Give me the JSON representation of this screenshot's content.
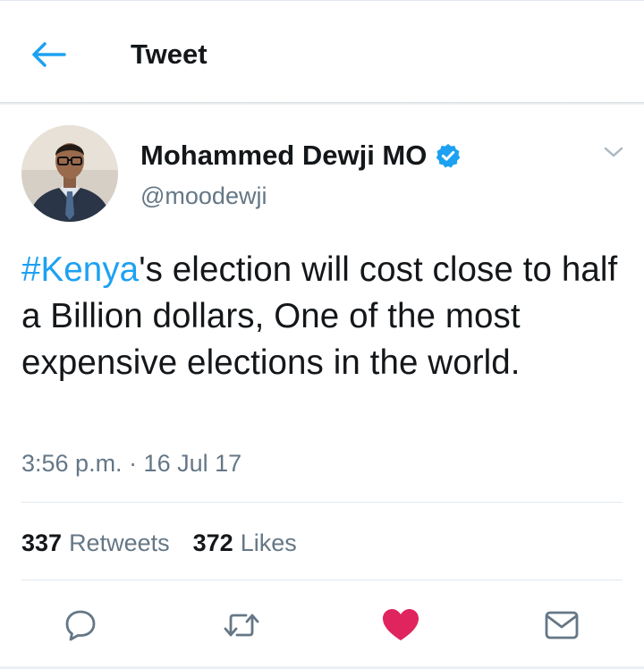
{
  "header": {
    "title": "Tweet",
    "back_icon": "back-arrow-icon"
  },
  "author": {
    "name": "Mohammed Dewji MO",
    "handle": "@moodewji",
    "verified": true,
    "verified_icon": "verified-badge-icon"
  },
  "tweet": {
    "hashtag": "#Kenya",
    "text": "'s election will cost close to half a Billion dollars, One of the most expensive elections in the world.",
    "timestamp": "3:56 p.m. · 16 Jul 17"
  },
  "stats": {
    "retweets_count": "337",
    "retweets_label": "Retweets",
    "likes_count": "372",
    "likes_label": "Likes"
  },
  "actions": {
    "reply_icon": "reply-bubble-icon",
    "retweet_icon": "retweet-icon",
    "like_icon": "heart-icon",
    "dm_icon": "envelope-icon",
    "liked": true
  },
  "colors": {
    "accent": "#1da1f2",
    "like": "#e0245e",
    "secondary_text": "#657786",
    "primary_text": "#14171a",
    "divider": "#e1e8ed"
  }
}
